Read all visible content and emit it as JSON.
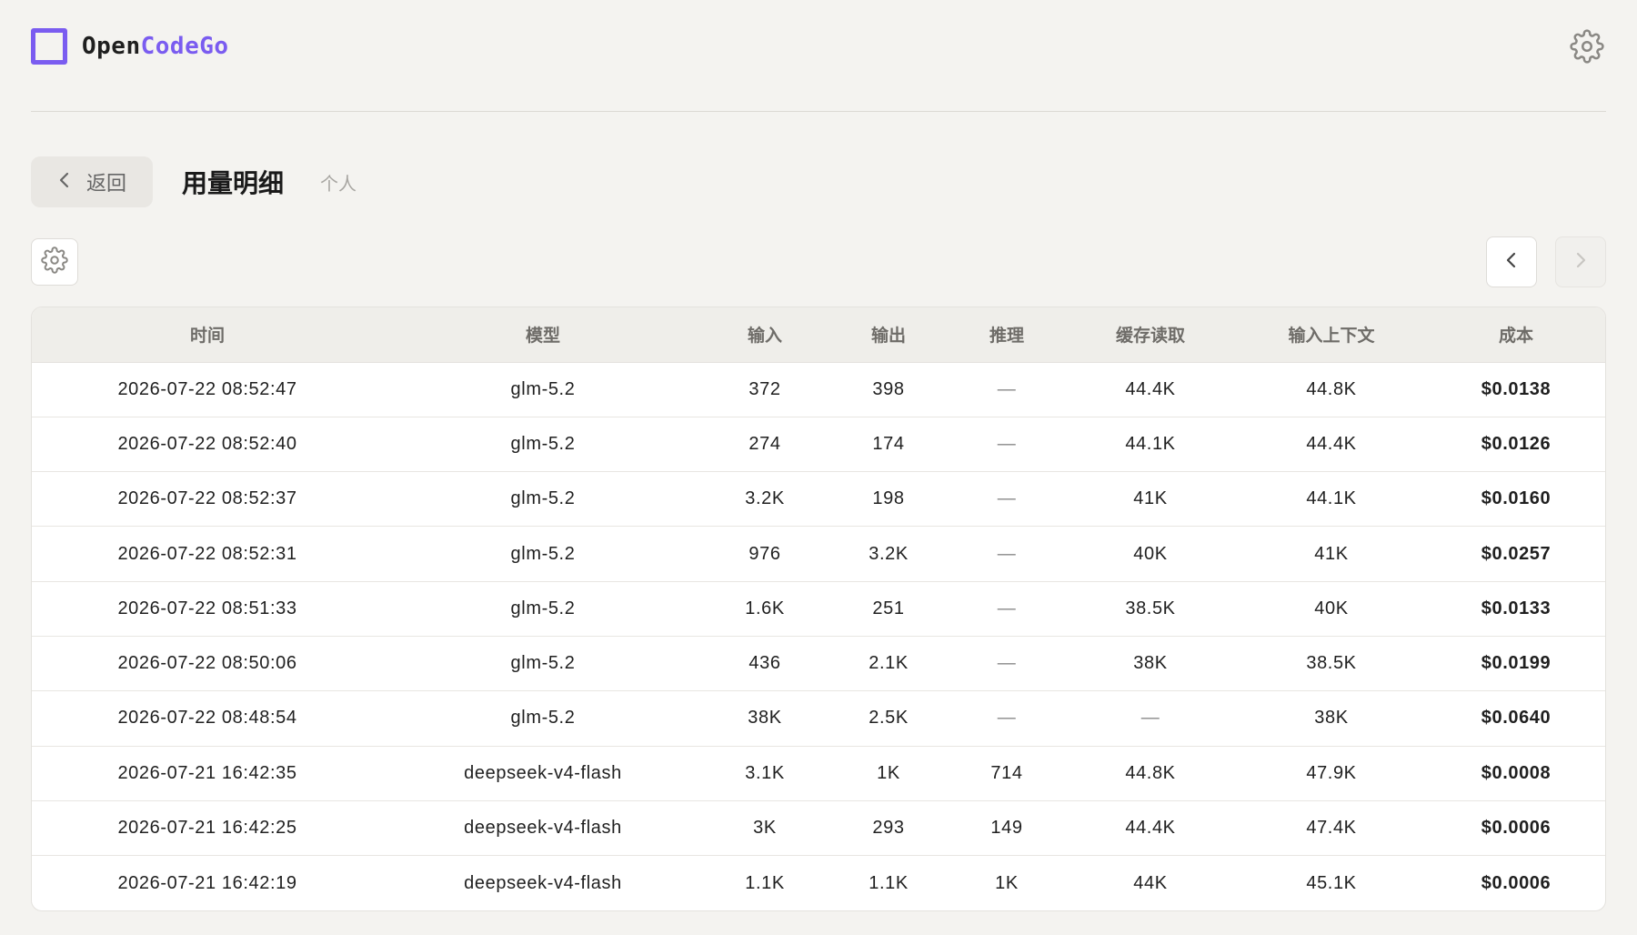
{
  "app": {
    "logo_part1": "Open",
    "logo_part2": "CodeGo",
    "accent_color": "#7a5cf0",
    "settings_icon": "gear-icon"
  },
  "header": {
    "back_label": "返回",
    "title": "用量明细",
    "scope": "个人"
  },
  "toolbar": {
    "settings_icon": "gear-icon",
    "prev_icon": "chevron-left-icon",
    "next_icon": "chevron-right-icon"
  },
  "table": {
    "columns": [
      "时间",
      "模型",
      "输入",
      "输出",
      "推理",
      "缓存读取",
      "输入上下文",
      "成本"
    ],
    "rows": [
      [
        "2026-07-22 08:52:47",
        "glm-5.2",
        "372",
        "398",
        "—",
        "44.4K",
        "44.8K",
        "$0.0138"
      ],
      [
        "2026-07-22 08:52:40",
        "glm-5.2",
        "274",
        "174",
        "—",
        "44.1K",
        "44.4K",
        "$0.0126"
      ],
      [
        "2026-07-22 08:52:37",
        "glm-5.2",
        "3.2K",
        "198",
        "—",
        "41K",
        "44.1K",
        "$0.0160"
      ],
      [
        "2026-07-22 08:52:31",
        "glm-5.2",
        "976",
        "3.2K",
        "—",
        "40K",
        "41K",
        "$0.0257"
      ],
      [
        "2026-07-22 08:51:33",
        "glm-5.2",
        "1.6K",
        "251",
        "—",
        "38.5K",
        "40K",
        "$0.0133"
      ],
      [
        "2026-07-22 08:50:06",
        "glm-5.2",
        "436",
        "2.1K",
        "—",
        "38K",
        "38.5K",
        "$0.0199"
      ],
      [
        "2026-07-22 08:48:54",
        "glm-5.2",
        "38K",
        "2.5K",
        "—",
        "—",
        "38K",
        "$0.0640"
      ],
      [
        "2026-07-21 16:42:35",
        "deepseek-v4-flash",
        "3.1K",
        "1K",
        "714",
        "44.8K",
        "47.9K",
        "$0.0008"
      ],
      [
        "2026-07-21 16:42:25",
        "deepseek-v4-flash",
        "3K",
        "293",
        "149",
        "44.4K",
        "47.4K",
        "$0.0006"
      ],
      [
        "2026-07-21 16:42:19",
        "deepseek-v4-flash",
        "1.1K",
        "1.1K",
        "1K",
        "44K",
        "45.1K",
        "$0.0006"
      ]
    ]
  }
}
